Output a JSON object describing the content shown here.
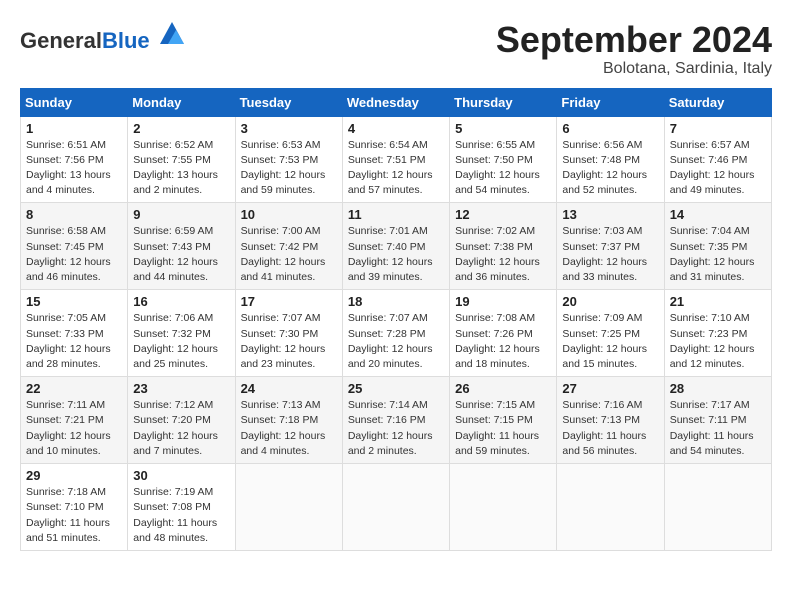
{
  "header": {
    "logo_general": "General",
    "logo_blue": "Blue",
    "month_title": "September 2024",
    "location": "Bolotana, Sardinia, Italy"
  },
  "days_of_week": [
    "Sunday",
    "Monday",
    "Tuesday",
    "Wednesday",
    "Thursday",
    "Friday",
    "Saturday"
  ],
  "weeks": [
    [
      {
        "day": 1,
        "info": "Sunrise: 6:51 AM\nSunset: 7:56 PM\nDaylight: 13 hours\nand 4 minutes."
      },
      {
        "day": 2,
        "info": "Sunrise: 6:52 AM\nSunset: 7:55 PM\nDaylight: 13 hours\nand 2 minutes."
      },
      {
        "day": 3,
        "info": "Sunrise: 6:53 AM\nSunset: 7:53 PM\nDaylight: 12 hours\nand 59 minutes."
      },
      {
        "day": 4,
        "info": "Sunrise: 6:54 AM\nSunset: 7:51 PM\nDaylight: 12 hours\nand 57 minutes."
      },
      {
        "day": 5,
        "info": "Sunrise: 6:55 AM\nSunset: 7:50 PM\nDaylight: 12 hours\nand 54 minutes."
      },
      {
        "day": 6,
        "info": "Sunrise: 6:56 AM\nSunset: 7:48 PM\nDaylight: 12 hours\nand 52 minutes."
      },
      {
        "day": 7,
        "info": "Sunrise: 6:57 AM\nSunset: 7:46 PM\nDaylight: 12 hours\nand 49 minutes."
      }
    ],
    [
      {
        "day": 8,
        "info": "Sunrise: 6:58 AM\nSunset: 7:45 PM\nDaylight: 12 hours\nand 46 minutes."
      },
      {
        "day": 9,
        "info": "Sunrise: 6:59 AM\nSunset: 7:43 PM\nDaylight: 12 hours\nand 44 minutes."
      },
      {
        "day": 10,
        "info": "Sunrise: 7:00 AM\nSunset: 7:42 PM\nDaylight: 12 hours\nand 41 minutes."
      },
      {
        "day": 11,
        "info": "Sunrise: 7:01 AM\nSunset: 7:40 PM\nDaylight: 12 hours\nand 39 minutes."
      },
      {
        "day": 12,
        "info": "Sunrise: 7:02 AM\nSunset: 7:38 PM\nDaylight: 12 hours\nand 36 minutes."
      },
      {
        "day": 13,
        "info": "Sunrise: 7:03 AM\nSunset: 7:37 PM\nDaylight: 12 hours\nand 33 minutes."
      },
      {
        "day": 14,
        "info": "Sunrise: 7:04 AM\nSunset: 7:35 PM\nDaylight: 12 hours\nand 31 minutes."
      }
    ],
    [
      {
        "day": 15,
        "info": "Sunrise: 7:05 AM\nSunset: 7:33 PM\nDaylight: 12 hours\nand 28 minutes."
      },
      {
        "day": 16,
        "info": "Sunrise: 7:06 AM\nSunset: 7:32 PM\nDaylight: 12 hours\nand 25 minutes."
      },
      {
        "day": 17,
        "info": "Sunrise: 7:07 AM\nSunset: 7:30 PM\nDaylight: 12 hours\nand 23 minutes."
      },
      {
        "day": 18,
        "info": "Sunrise: 7:07 AM\nSunset: 7:28 PM\nDaylight: 12 hours\nand 20 minutes."
      },
      {
        "day": 19,
        "info": "Sunrise: 7:08 AM\nSunset: 7:26 PM\nDaylight: 12 hours\nand 18 minutes."
      },
      {
        "day": 20,
        "info": "Sunrise: 7:09 AM\nSunset: 7:25 PM\nDaylight: 12 hours\nand 15 minutes."
      },
      {
        "day": 21,
        "info": "Sunrise: 7:10 AM\nSunset: 7:23 PM\nDaylight: 12 hours\nand 12 minutes."
      }
    ],
    [
      {
        "day": 22,
        "info": "Sunrise: 7:11 AM\nSunset: 7:21 PM\nDaylight: 12 hours\nand 10 minutes."
      },
      {
        "day": 23,
        "info": "Sunrise: 7:12 AM\nSunset: 7:20 PM\nDaylight: 12 hours\nand 7 minutes."
      },
      {
        "day": 24,
        "info": "Sunrise: 7:13 AM\nSunset: 7:18 PM\nDaylight: 12 hours\nand 4 minutes."
      },
      {
        "day": 25,
        "info": "Sunrise: 7:14 AM\nSunset: 7:16 PM\nDaylight: 12 hours\nand 2 minutes."
      },
      {
        "day": 26,
        "info": "Sunrise: 7:15 AM\nSunset: 7:15 PM\nDaylight: 11 hours\nand 59 minutes."
      },
      {
        "day": 27,
        "info": "Sunrise: 7:16 AM\nSunset: 7:13 PM\nDaylight: 11 hours\nand 56 minutes."
      },
      {
        "day": 28,
        "info": "Sunrise: 7:17 AM\nSunset: 7:11 PM\nDaylight: 11 hours\nand 54 minutes."
      }
    ],
    [
      {
        "day": 29,
        "info": "Sunrise: 7:18 AM\nSunset: 7:10 PM\nDaylight: 11 hours\nand 51 minutes."
      },
      {
        "day": 30,
        "info": "Sunrise: 7:19 AM\nSunset: 7:08 PM\nDaylight: 11 hours\nand 48 minutes."
      },
      null,
      null,
      null,
      null,
      null
    ]
  ]
}
